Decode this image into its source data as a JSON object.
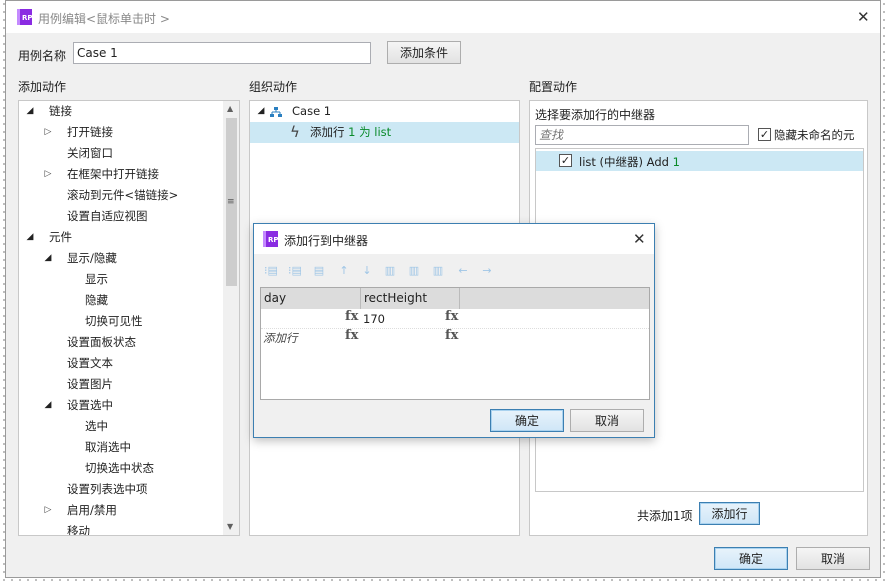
{
  "window": {
    "title": "用例编辑<鼠标单击时 >",
    "logo_text": "RP"
  },
  "case_name": {
    "label": "用例名称",
    "value": "Case 1",
    "add_condition_label": "添加条件"
  },
  "sections": {
    "add_action": "添加动作",
    "organize_action": "组织动作",
    "configure_action": "配置动作"
  },
  "actions_tree": [
    {
      "label": "链接",
      "level": 0,
      "state": "open"
    },
    {
      "label": "打开链接",
      "level": 1,
      "state": "closed"
    },
    {
      "label": "关闭窗口",
      "level": 1,
      "state": "none"
    },
    {
      "label": "在框架中打开链接",
      "level": 1,
      "state": "closed"
    },
    {
      "label": "滚动到元件<锚链接>",
      "level": 1,
      "state": "none"
    },
    {
      "label": "设置自适应视图",
      "level": 1,
      "state": "none"
    },
    {
      "label": "元件",
      "level": 0,
      "state": "open"
    },
    {
      "label": "显示/隐藏",
      "level": 1,
      "state": "open"
    },
    {
      "label": "显示",
      "level": 2,
      "state": "none"
    },
    {
      "label": "隐藏",
      "level": 2,
      "state": "none"
    },
    {
      "label": "切换可见性",
      "level": 2,
      "state": "none"
    },
    {
      "label": "设置面板状态",
      "level": 1,
      "state": "none"
    },
    {
      "label": "设置文本",
      "level": 1,
      "state": "none"
    },
    {
      "label": "设置图片",
      "level": 1,
      "state": "none"
    },
    {
      "label": "设置选中",
      "level": 1,
      "state": "open"
    },
    {
      "label": "选中",
      "level": 2,
      "state": "none"
    },
    {
      "label": "取消选中",
      "level": 2,
      "state": "none"
    },
    {
      "label": "切换选中状态",
      "level": 2,
      "state": "none"
    },
    {
      "label": "设置列表选中项",
      "level": 1,
      "state": "none"
    },
    {
      "label": "启用/禁用",
      "level": 1,
      "state": "closed"
    },
    {
      "label": "移动",
      "level": 1,
      "state": "none"
    }
  ],
  "organize": {
    "case_label": "Case 1",
    "action_prefix": "添加行 ",
    "action_count": "1",
    "action_mid": " 为 ",
    "action_target": "list"
  },
  "configure": {
    "heading": "选择要添加行的中继器",
    "search_placeholder": "查找",
    "hide_unnamed_label": "隐藏未命名的元",
    "hide_unnamed_checked": true,
    "repeater_item_prefix": "list (中继器) Add ",
    "repeater_item_count": "1",
    "repeater_checked": true,
    "total_label": "共添加1项",
    "add_row_label": "添加行"
  },
  "footer": {
    "ok_label": "确定",
    "cancel_label": "取消"
  },
  "dialog": {
    "title": "添加行到中继器",
    "columns": [
      "day",
      "rectHeight"
    ],
    "fx_label": "fx",
    "row1_value": "170",
    "add_row_hint": "添加行",
    "ok_label": "确定",
    "cancel_label": "取消"
  },
  "colors": {
    "accent": "#3c7fb1",
    "selection": "#cce8f4",
    "green": "#0a8a2a",
    "logo": "#8a2be2"
  }
}
